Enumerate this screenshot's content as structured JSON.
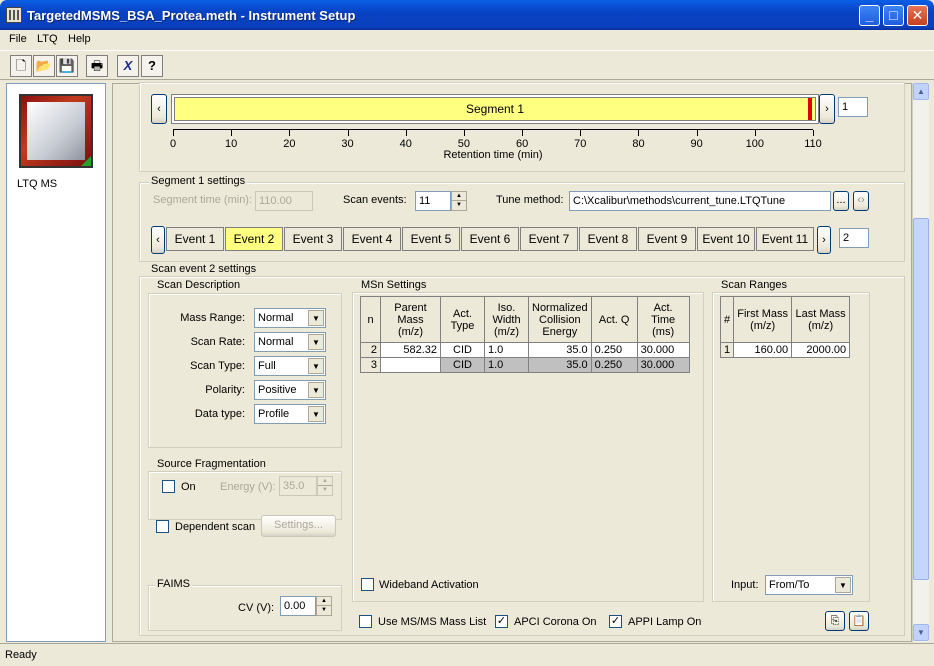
{
  "window": {
    "title": "TargetedMSMS_BSA_Protea.meth - Instrument Setup"
  },
  "menu": [
    "File",
    "LTQ",
    "Help"
  ],
  "toolbar": [
    "new-icon",
    "open-icon",
    "save-icon",
    "print-icon",
    "cross-icon",
    "help-icon"
  ],
  "left_pane": {
    "instrument_label": "LTQ MS"
  },
  "segment_bar": {
    "label": "Segment 1",
    "ticks": [
      "0",
      "10",
      "20",
      "30",
      "40",
      "50",
      "60",
      "70",
      "80",
      "90",
      "100",
      "110"
    ],
    "axis_label": "Retention time (min)",
    "number": "1"
  },
  "segment_settings": {
    "title": "Segment 1 settings",
    "segment_time_label": "Segment time (min):",
    "segment_time_value": "110.00",
    "scan_events_label": "Scan events:",
    "scan_events_value": "11",
    "tune_method_label": "Tune method:",
    "tune_method_value": "C:\\Xcalibur\\methods\\current_tune.LTQTune",
    "browse_label": "...",
    "events": [
      "Event 1",
      "Event 2",
      "Event 3",
      "Event 4",
      "Event 5",
      "Event 6",
      "Event 7",
      "Event 8",
      "Event 9",
      "Event 10",
      "Event 11"
    ],
    "active_event": "Event 2",
    "event_number": "2"
  },
  "scan_event_settings": {
    "title": "Scan event 2 settings",
    "scan_description": {
      "title": "Scan Description",
      "rows": [
        {
          "label": "Mass Range:",
          "value": "Normal"
        },
        {
          "label": "Scan Rate:",
          "value": "Normal"
        },
        {
          "label": "Scan Type:",
          "value": "Full"
        },
        {
          "label": "Polarity:",
          "value": "Positive"
        },
        {
          "label": "Data type:",
          "value": "Profile"
        }
      ]
    },
    "source_fragmentation": {
      "title": "Source Fragmentation",
      "on_label": "On",
      "energy_label": "Energy (V):",
      "energy_value": "35.0"
    },
    "dependent_scan_label": "Dependent scan",
    "settings_button": "Settings...",
    "faims": {
      "title": "FAIMS",
      "cv_label": "CV (V):",
      "cv_value": "0.00"
    },
    "msn_settings": {
      "title": "MSn Settings",
      "headers": [
        "n",
        "Parent Mass (m/z)",
        "Act. Type",
        "Iso. Width (m/z)",
        "Normalized Collision Energy",
        "Act. Q",
        "Act. Time (ms)"
      ],
      "rows": [
        [
          "2",
          "582.32",
          "CID",
          "1.0",
          "35.0",
          "0.250",
          "30.000"
        ],
        [
          "3",
          "",
          "CID",
          "1.0",
          "35.0",
          "0.250",
          "30.000"
        ]
      ],
      "wideband_label": "Wideband Activation"
    },
    "scan_ranges": {
      "title": "Scan Ranges",
      "headers": [
        "#",
        "First Mass (m/z)",
        "Last Mass (m/z)"
      ],
      "rows": [
        [
          "1",
          "160.00",
          "2000.00"
        ]
      ],
      "input_label": "Input:",
      "input_value": "From/To"
    },
    "bottom_checks": [
      {
        "label": "Use MS/MS Mass List",
        "checked": false
      },
      {
        "label": "APCI Corona On",
        "checked": true
      },
      {
        "label": "APPI Lamp On",
        "checked": true
      }
    ]
  },
  "status": {
    "text": "Ready"
  }
}
